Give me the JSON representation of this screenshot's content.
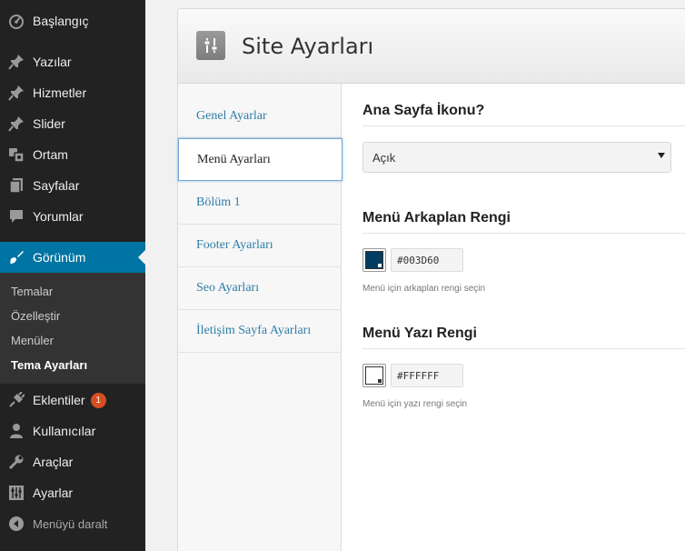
{
  "sidebar": {
    "items": [
      {
        "label": "Başlangıç",
        "icon": "dashboard-icon"
      },
      {
        "label": "Yazılar",
        "icon": "pushpin-icon"
      },
      {
        "label": "Hizmetler",
        "icon": "pushpin-icon"
      },
      {
        "label": "Slider",
        "icon": "pushpin-icon"
      },
      {
        "label": "Ortam",
        "icon": "media-icon"
      },
      {
        "label": "Sayfalar",
        "icon": "pages-icon"
      },
      {
        "label": "Yorumlar",
        "icon": "comment-icon"
      },
      {
        "label": "Görünüm",
        "icon": "paintbrush-icon"
      },
      {
        "label": "Eklentiler",
        "icon": "plugin-icon",
        "badge": "1"
      },
      {
        "label": "Kullanıcılar",
        "icon": "users-icon"
      },
      {
        "label": "Araçlar",
        "icon": "wrench-icon"
      },
      {
        "label": "Ayarlar",
        "icon": "settings-icon"
      },
      {
        "label": "Menüyü daralt",
        "icon": "collapse-icon"
      }
    ],
    "submenu": [
      "Temalar",
      "Özelleştir",
      "Menüler",
      "Tema Ayarları"
    ],
    "accent": "#0074a2"
  },
  "panel": {
    "title": "Site Ayarları",
    "tabs": [
      "Genel Ayarlar",
      "Menü Ayarları",
      "Bölüm 1",
      "Footer Ayarları",
      "Seo Ayarları",
      "İletişim Sayfa Ayarları"
    ],
    "active_tab": "Menü Ayarları"
  },
  "content": {
    "icon_section": {
      "title": "Ana Sayfa İkonu?",
      "selected": "Açık"
    },
    "bg_section": {
      "title": "Menü Arkaplan Rengi",
      "value": "#003D60",
      "hint": "Menü için arkaplan rengi seçin",
      "color": "#003d60"
    },
    "text_section": {
      "title": "Menü Yazı Rengi",
      "value": "#FFFFFF",
      "hint": "Menü için yazı rengi seçin",
      "color": "#ffffff"
    }
  }
}
